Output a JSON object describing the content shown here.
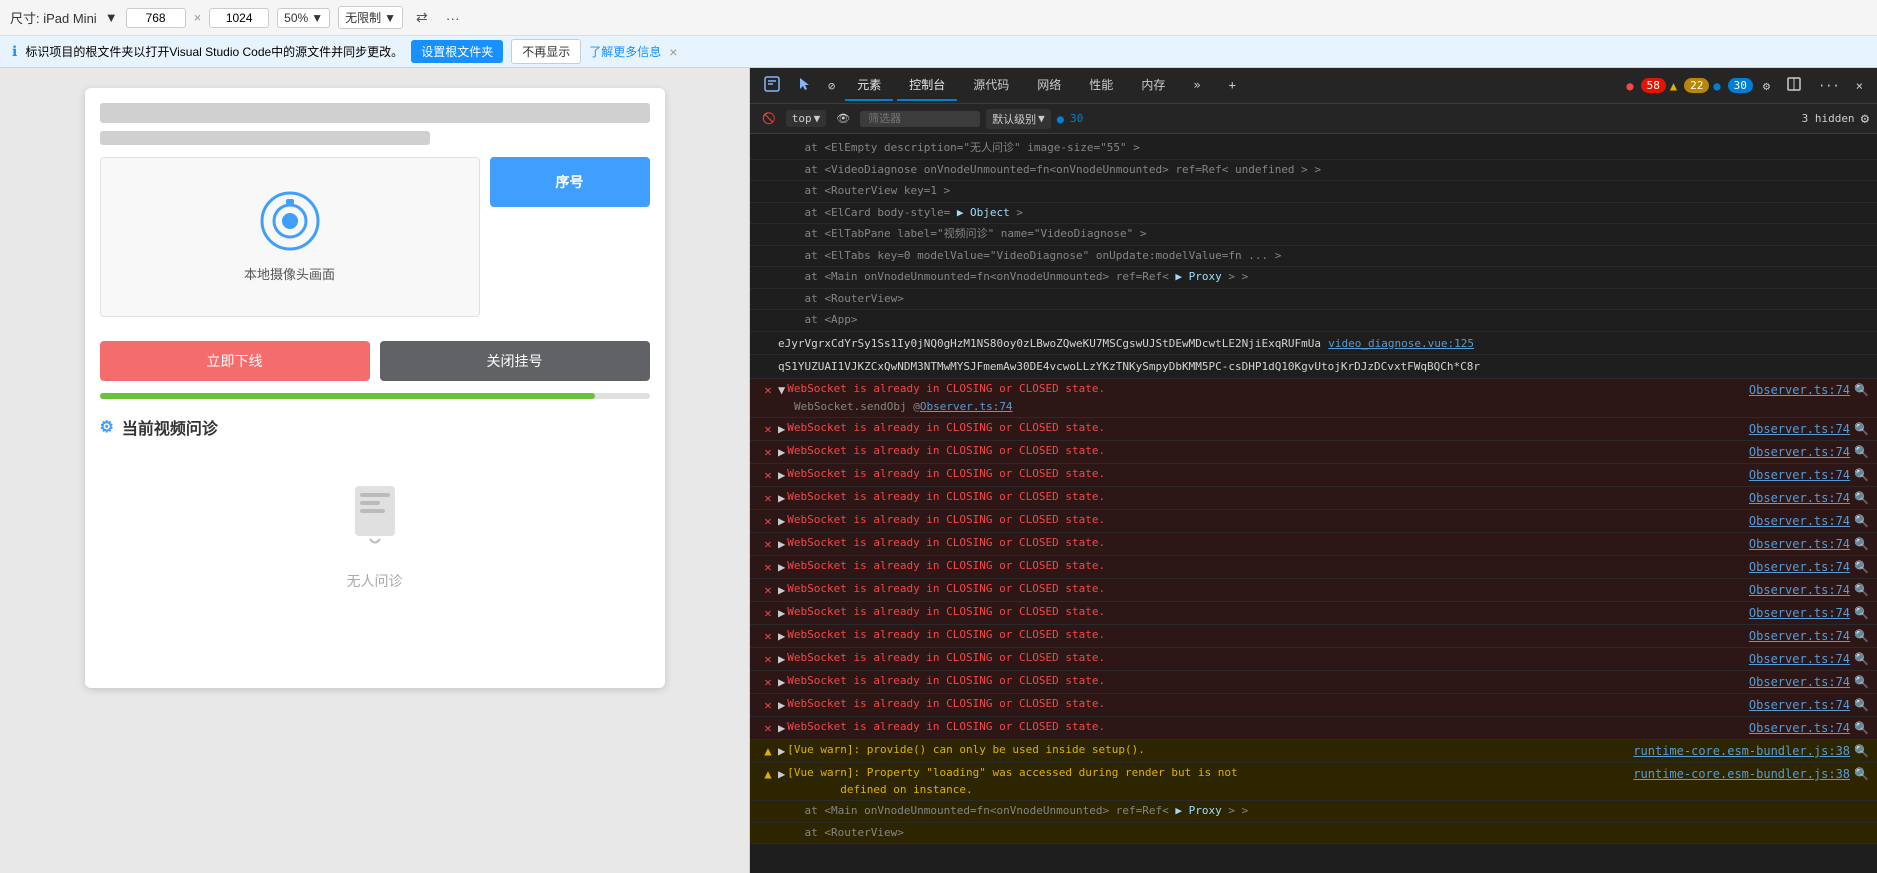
{
  "toolbar": {
    "size_label": "尺寸: iPad Mini",
    "size_dropdown_arrow": "▼",
    "width_value": "768",
    "cross": "×",
    "height_value": "1024",
    "zoom_value": "50%",
    "zoom_arrow": "▼",
    "limit_label": "无限制",
    "limit_arrow": "▼",
    "rotate_icon": "⇄",
    "more_icon": "···"
  },
  "notification": {
    "icon": "ℹ",
    "text": "标识项目的根文件夹以打开Visual Studio Code中的源文件并同步更改。",
    "setup_btn": "设置根文件夹",
    "no_show_btn": "不再显示",
    "learn_more": "了解更多信息",
    "close": "×"
  },
  "app": {
    "seq_btn": "序号",
    "camera_label": "本地摄像头画面",
    "offline_btn": "立即下线",
    "hangup_btn": "关闭挂号",
    "progress_pct": 90,
    "section_title": "当前视频问诊",
    "empty_label": "无人问诊"
  },
  "devtools": {
    "tabs": [
      {
        "label": "▶",
        "icon": true
      },
      {
        "label": "⊘",
        "icon": true
      },
      {
        "label": "元素"
      },
      {
        "label": "控制台"
      },
      {
        "label": "源代码"
      },
      {
        "label": "网络"
      },
      {
        "label": "性能"
      },
      {
        "label": "内存"
      },
      {
        "label": "»",
        "icon": true
      }
    ],
    "active_tab": "控制台",
    "error_count": "58",
    "warn_count": "22",
    "info_count": "30",
    "settings_icon": "⚙",
    "more_icon": "···",
    "close_icon": "×",
    "console": {
      "top_label": "top",
      "filter_placeholder": "筛选器",
      "level_label": "默认级别",
      "level_arrow": "▼",
      "info_badge": "30",
      "hidden_count": "3 hidden",
      "settings_icon": "⚙"
    },
    "stack_lines": [
      "at <ElEmpty description=\"无人问诊\" image-size=\"55\" >",
      "at <VideoDiagnose onVnodeUnmounted=fn<onVnodeUnmounted> ref=Ref< undefined > >",
      "at <RouterView key=1 >",
      "at <ElCard body-style= ▶ Object >",
      "at <ElTabPane label=\"视频问诊\" name=\"VideoDiagnose\" >",
      "at <ElTabs key=0 modelValue=\"VideoDiagnose\" onUpdate:modelValue=fn ... >",
      "at <Main onVnodeUnmounted=fn<onVnodeUnmounted> ref=Ref< ▶ Proxy > >",
      "at <RouterView>",
      "at <App>"
    ],
    "long_line": "eJyrVgrxCdYrSy1Ss1Iy0jNQ0gHzM1NS80oy0zLBwoZQweKU7MSCgswUJStDEwMDcwtLE2NjiExqRUFmUa video_diagnose.vue:125",
    "long_line2": "qS1YUZUAI1VJKZCxQwNDM3NTMwMYSJFmemAw30DE4vcwoLLzYKzTNKySmpyDbKMM5PC-csDHP1dQ10KgvUtojKrDJzDCvxtFWqBQCh*C8r",
    "errors": [
      {
        "type": "error",
        "expandable": true,
        "text": "WebSocket is already in CLOSING or CLOSED state.",
        "source": "Observer.ts:74",
        "sub": "WebSocket.sendObj @ Observer.ts:74"
      },
      {
        "type": "error",
        "expandable": true,
        "text": "WebSocket is already in CLOSING or CLOSED state.",
        "source": "Observer.ts:74"
      },
      {
        "type": "error",
        "expandable": true,
        "text": "WebSocket is already in CLOSING or CLOSED state.",
        "source": "Observer.ts:74"
      },
      {
        "type": "error",
        "expandable": true,
        "text": "WebSocket is already in CLOSING or CLOSED state.",
        "source": "Observer.ts:74"
      },
      {
        "type": "error",
        "expandable": true,
        "text": "WebSocket is already in CLOSING or CLOSED state.",
        "source": "Observer.ts:74"
      },
      {
        "type": "error",
        "expandable": true,
        "text": "WebSocket is already in CLOSING or CLOSED state.",
        "source": "Observer.ts:74"
      },
      {
        "type": "error",
        "expandable": true,
        "text": "WebSocket is already in CLOSING or CLOSED state.",
        "source": "Observer.ts:74"
      },
      {
        "type": "error",
        "expandable": true,
        "text": "WebSocket is already in CLOSING or CLOSED state.",
        "source": "Observer.ts:74"
      },
      {
        "type": "error",
        "expandable": true,
        "text": "WebSocket is already in CLOSING or CLOSED state.",
        "source": "Observer.ts:74"
      },
      {
        "type": "error",
        "expandable": true,
        "text": "WebSocket is already in CLOSING or CLOSED state.",
        "source": "Observer.ts:74"
      },
      {
        "type": "error",
        "expandable": true,
        "text": "WebSocket is already in CLOSING or CLOSED state.",
        "source": "Observer.ts:74"
      },
      {
        "type": "error",
        "expandable": true,
        "text": "WebSocket is already in CLOSING or CLOSED state.",
        "source": "Observer.ts:74"
      },
      {
        "type": "error",
        "expandable": true,
        "text": "WebSocket is already in CLOSING or CLOSED state.",
        "source": "Observer.ts:74"
      },
      {
        "type": "error",
        "expandable": true,
        "text": "WebSocket is already in CLOSING or CLOSED state.",
        "source": "Observer.ts:74"
      },
      {
        "type": "error",
        "expandable": true,
        "text": "WebSocket is already in CLOSING or CLOSED state.",
        "source": "Observer.ts:74"
      }
    ],
    "warnings": [
      {
        "type": "warn",
        "expandable": true,
        "text": "[Vue warn]: provide() can only be used inside setup().",
        "source": "runtime-core.esm-bundler.js:38"
      },
      {
        "type": "warn",
        "expandable": true,
        "text": "[Vue warn]: Property \"loading\" was accessed during render but is not defined on instance.",
        "source": "runtime-core.esm-bundler.js:38"
      }
    ],
    "stack_bottom": [
      "at <Main onVnodeUnmounted=fn<onVnodeUnmounted> ref=Ref< ▶ Proxy > >",
      "at <RouterView>"
    ]
  }
}
